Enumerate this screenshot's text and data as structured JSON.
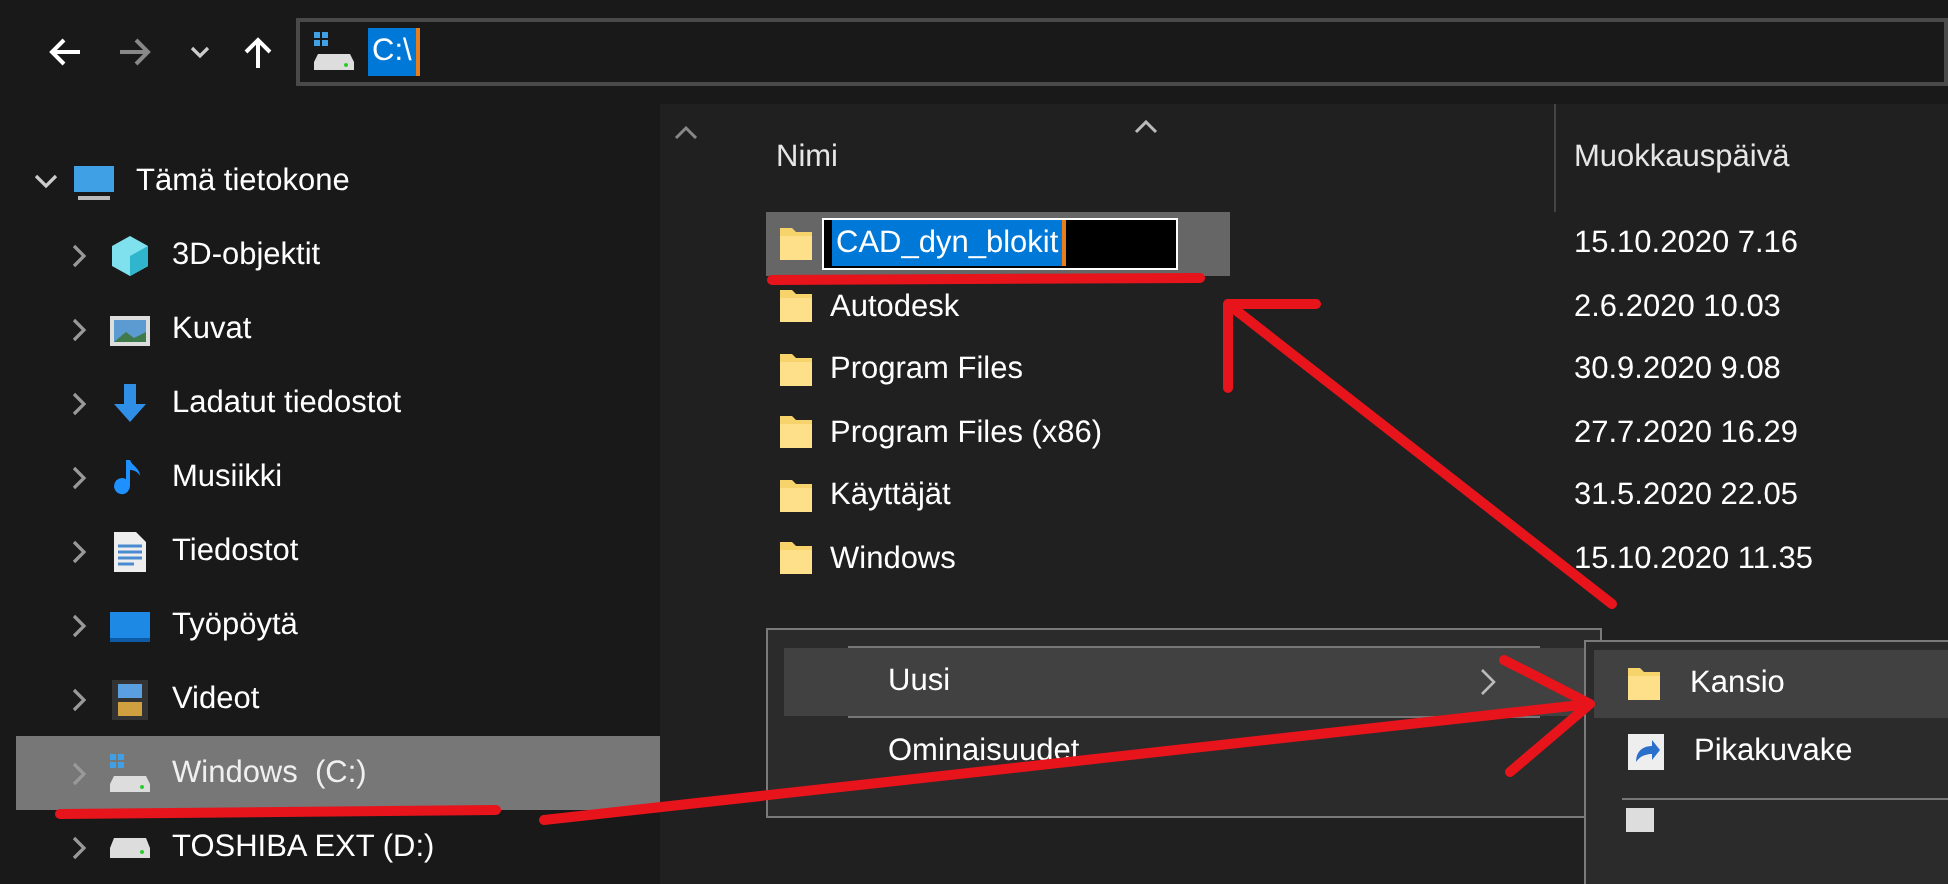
{
  "toolbar": {
    "address": "C:\\",
    "address_selected": true
  },
  "sidebar": {
    "items": [
      {
        "label": "Tämä tietokone",
        "kind": "computer",
        "expanded": true,
        "selected": false,
        "children": [
          {
            "label": "3D-objektit",
            "kind": "cube",
            "expanded": false,
            "selected": false
          },
          {
            "label": "Kuvat",
            "kind": "picture",
            "expanded": false,
            "selected": false
          },
          {
            "label": "Ladatut tiedostot",
            "kind": "download",
            "expanded": false,
            "selected": false
          },
          {
            "label": "Musiikki",
            "kind": "music",
            "expanded": false,
            "selected": false
          },
          {
            "label": "Tiedostot",
            "kind": "document",
            "expanded": false,
            "selected": false
          },
          {
            "label": "Työpöytä",
            "kind": "desktop",
            "expanded": false,
            "selected": false
          },
          {
            "label": "Videot",
            "kind": "video",
            "expanded": false,
            "selected": false
          },
          {
            "label": "Windows  (C:)",
            "kind": "system-drive",
            "expanded": false,
            "selected": true
          },
          {
            "label": "TOSHIBA EXT (D:)",
            "kind": "drive",
            "expanded": false,
            "selected": false
          }
        ]
      }
    ]
  },
  "files": {
    "columns": [
      "Nimi",
      "Muokkauspäivä"
    ],
    "rows": [
      {
        "name": "CAD_dyn_blokit",
        "date": "15.10.2020 7.16",
        "selected": true,
        "renaming": true
      },
      {
        "name": "Autodesk",
        "date": "2.6.2020 10.03",
        "selected": false,
        "renaming": false
      },
      {
        "name": "Program Files",
        "date": "30.9.2020 9.08",
        "selected": false,
        "renaming": false
      },
      {
        "name": "Program Files (x86)",
        "date": "27.7.2020 16.29",
        "selected": false,
        "renaming": false
      },
      {
        "name": "Käyttäjät",
        "date": "31.5.2020 22.05",
        "selected": false,
        "renaming": false
      },
      {
        "name": "Windows",
        "date": "15.10.2020 11.35",
        "selected": false,
        "renaming": false
      }
    ]
  },
  "context_menu": {
    "items": [
      {
        "label": "Uusi",
        "selected": true,
        "submenu": true
      },
      {
        "label": "Ominaisuudet",
        "selected": false,
        "submenu": false
      }
    ]
  },
  "submenu": {
    "items": [
      {
        "label": "Kansio",
        "kind": "folder",
        "selected": true
      },
      {
        "label": "Pikakuvake",
        "kind": "shortcut",
        "selected": false
      }
    ]
  }
}
